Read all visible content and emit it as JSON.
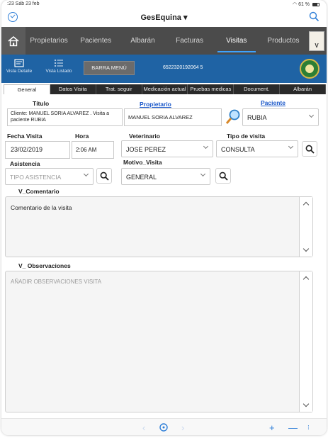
{
  "status": {
    "time_date": ":23  Sáb 23 feb",
    "battery": "61 %"
  },
  "app": {
    "title": "GesEquina",
    "title_caret": "▾"
  },
  "nav": {
    "tabs": [
      {
        "label": "Propietarios"
      },
      {
        "label": "Pacientes"
      },
      {
        "label": "Albarán"
      },
      {
        "label": "Facturas"
      },
      {
        "label": "Visitas"
      },
      {
        "label": "Productos"
      }
    ],
    "active_tab": "Visitas",
    "logo_letter": "V"
  },
  "toolbar": {
    "view_detail": "Vista Detalle",
    "view_list": "Vista Listado",
    "menu_button": "BARRA MENÚ",
    "record_id": "6522320192064 5"
  },
  "subtabs": [
    {
      "label": "General"
    },
    {
      "label": "Datos Visita"
    },
    {
      "label": "Trat. seguir"
    },
    {
      "label": "Medicación actual"
    },
    {
      "label": "Pruebas medicas"
    },
    {
      "label": "Document."
    },
    {
      "label": "Albarán"
    }
  ],
  "form": {
    "titulo_label": "Título",
    "titulo_value": "Cliente: MANUEL SORIA ALVAREZ . Visita a paciente RUBIA",
    "propietario_label": "Propietario",
    "propietario_value": "MANUEL SORIA ALVAREZ",
    "paciente_label": "Paciente",
    "paciente_value": "RUBIA",
    "fecha_label": "Fecha Visita",
    "fecha_value": "23/02/2019",
    "hora_label": "Hora",
    "hora_value": "2:06 AM",
    "veterinario_label": "Veterinario",
    "veterinario_value": "JOSE PEREZ",
    "tipo_label": "Tipo de visita",
    "tipo_value": "CONSULTA",
    "asistencia_label": "Asistencia",
    "asistencia_placeholder": "TIPO ASISTENCIA",
    "motivo_label": "Motivo_Visita",
    "motivo_value": "GENERAL",
    "comentario_label": "V_Comentario",
    "comentario_value": "Comentario de la visita",
    "observaciones_label": "V_ Observaciones",
    "observaciones_placeholder": "AÑADIR OBSERVACIONES VISITA"
  },
  "colors": {
    "nav_bg": "#4b4b4b",
    "toolbar_bg": "#1f63a4",
    "link": "#1b58c9",
    "accent": "#2f7fd8"
  }
}
